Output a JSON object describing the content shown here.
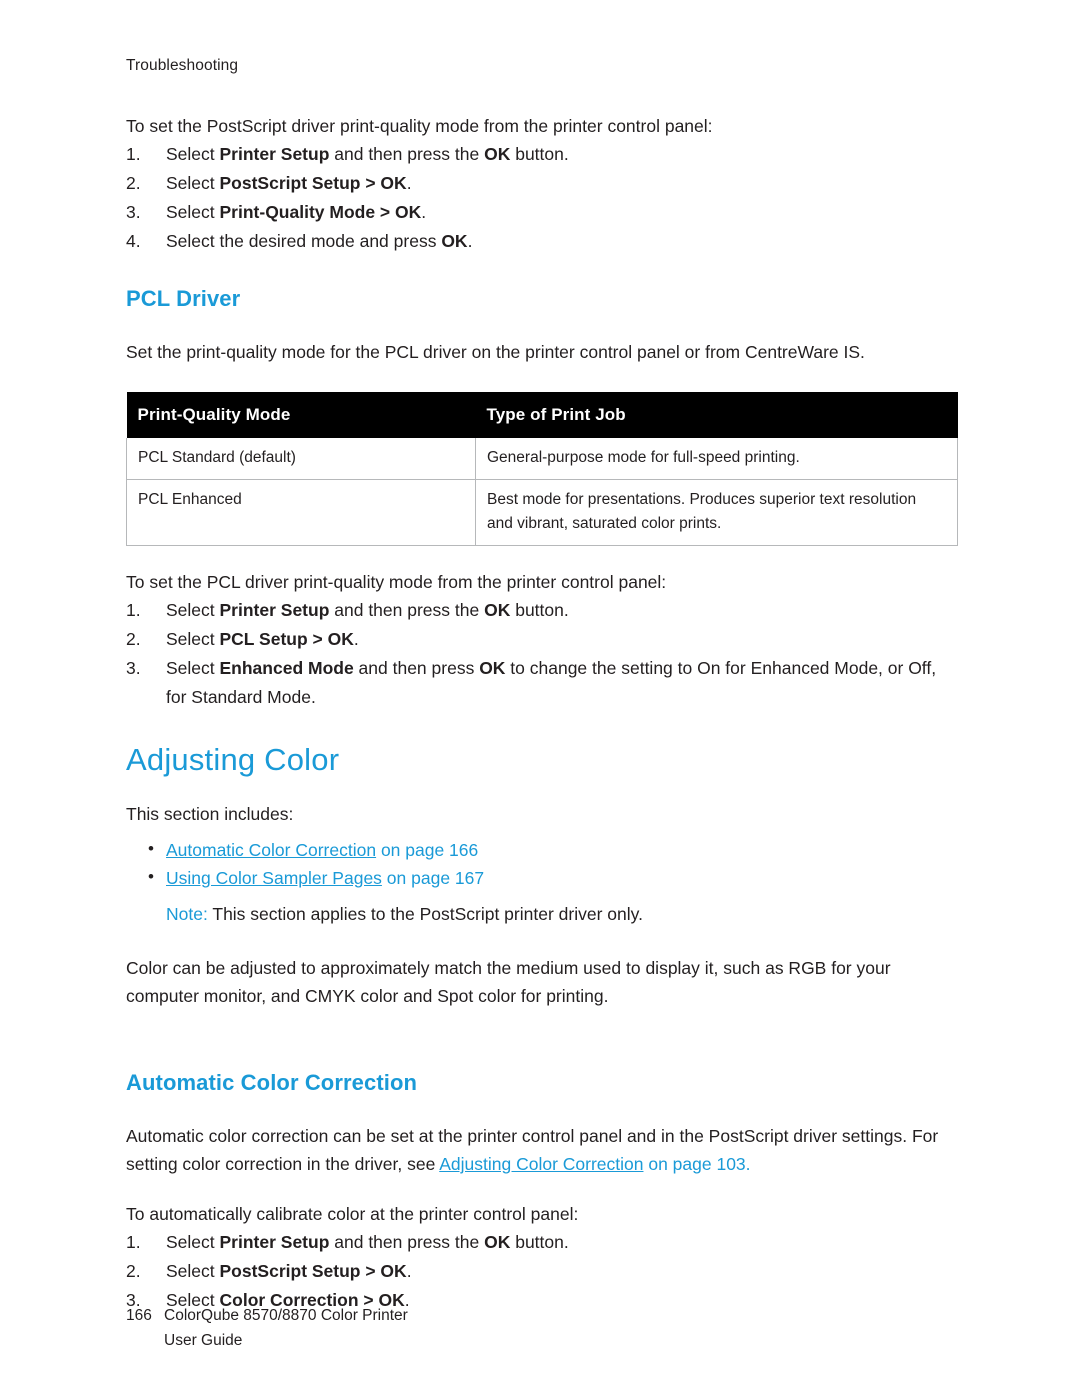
{
  "header": {
    "running_head": "Troubleshooting"
  },
  "ps_driver": {
    "intro": "To set the PostScript driver print-quality mode from the printer control panel:",
    "steps": [
      {
        "num": "1.",
        "pre": "Select ",
        "bold1": "Printer Setup",
        "mid": " and then press the ",
        "bold2": "OK",
        "post": " button."
      },
      {
        "num": "2.",
        "pre": "Select ",
        "bold1": "PostScript Setup > OK",
        "mid": "",
        "bold2": "",
        "post": "."
      },
      {
        "num": "3.",
        "pre": "Select ",
        "bold1": "Print-Quality Mode > OK",
        "mid": "",
        "bold2": "",
        "post": "."
      },
      {
        "num": "4.",
        "pre": "Select the desired mode and press ",
        "bold1": "OK",
        "mid": "",
        "bold2": "",
        "post": "."
      }
    ]
  },
  "pcl": {
    "heading": "PCL Driver",
    "intro": "Set the print-quality mode for the PCL driver on the printer control panel or from CentreWare IS.",
    "table": {
      "headers": [
        "Print-Quality Mode",
        "Type of Print Job"
      ],
      "rows": [
        [
          "PCL Standard (default)",
          "General-purpose mode for full-speed printing."
        ],
        [
          "PCL Enhanced",
          "Best mode for presentations. Produces superior text resolution and vibrant, saturated color prints."
        ]
      ]
    },
    "steps_intro": "To set the PCL driver print-quality mode from the printer control panel:",
    "steps": [
      {
        "num": "1.",
        "pre": "Select ",
        "bold1": "Printer Setup",
        "mid": " and then press the ",
        "bold2": "OK",
        "post": " button."
      },
      {
        "num": "2.",
        "pre": "Select ",
        "bold1": "PCL Setup > OK",
        "mid": "",
        "bold2": "",
        "post": "."
      },
      {
        "num": "3.",
        "pre": "Select ",
        "bold1": "Enhanced Mode",
        "mid": " and then press ",
        "bold2": "OK",
        "post": " to change the setting to On for Enhanced Mode, or Off, for Standard Mode."
      }
    ]
  },
  "adjusting_color": {
    "title": "Adjusting Color",
    "includes_label": "This section includes:",
    "bullets": [
      {
        "link": "Automatic Color Correction",
        "tail": " on page 166"
      },
      {
        "link": "Using Color Sampler Pages",
        "tail": " on page 167"
      }
    ],
    "note_label": "Note:",
    "note_text": " This section applies to the PostScript printer driver only.",
    "paragraph": "Color can be adjusted to approximately match the medium used to display it, such as RGB for your computer monitor, and CMYK color and Spot color for printing."
  },
  "automatic_color_correction": {
    "heading": "Automatic Color Correction",
    "para_line1": "Automatic color correction can be set at the printer control panel and in the PostScript driver settings.",
    "para_line2_pre": "For setting color correction in the driver, see ",
    "para_line2_link": "Adjusting Color Correction",
    "para_line2_post": " on page 103.",
    "steps_intro": "To automatically calibrate color at the printer control panel:",
    "steps": [
      {
        "num": "1.",
        "pre": "Select ",
        "bold1": "Printer Setup",
        "mid": " and then press the ",
        "bold2": "OK",
        "post": " button."
      },
      {
        "num": "2.",
        "pre": "Select ",
        "bold1": "PostScript Setup > OK",
        "mid": "",
        "bold2": "",
        "post": "."
      },
      {
        "num": "3.",
        "pre": "Select ",
        "bold1": "Color Correction > OK",
        "mid": "",
        "bold2": "",
        "post": "."
      }
    ]
  },
  "footer": {
    "page_number": "166",
    "product": "ColorQube 8570/8870 Color Printer",
    "doc": "User Guide"
  },
  "colors": {
    "accent": "#1a9ad7",
    "text": "#231f20",
    "table_header_bg": "#000000",
    "table_border": "#b6b8ba"
  }
}
